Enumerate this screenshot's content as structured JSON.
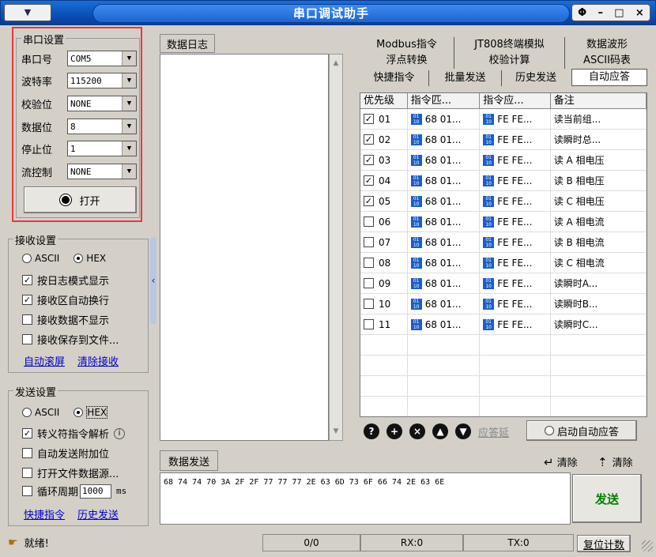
{
  "title": "串口调试助手",
  "window_ctrls": {
    "restore": "Φ",
    "min": "–",
    "max": "□",
    "close": "×"
  },
  "serial": {
    "group": "串口设置",
    "rows": [
      {
        "label": "串口号",
        "value": "COM5"
      },
      {
        "label": "波特率",
        "value": "115200"
      },
      {
        "label": "校验位",
        "value": "NONE"
      },
      {
        "label": "数据位",
        "value": "8"
      },
      {
        "label": "停止位",
        "value": "1"
      },
      {
        "label": "流控制",
        "value": "NONE"
      }
    ],
    "open_btn": "打开"
  },
  "receive": {
    "group": "接收设置",
    "ascii": "ASCII",
    "hex": "HEX",
    "opts": [
      "按日志模式显示",
      "接收区自动换行",
      "接收数据不显示",
      "接收保存到文件..."
    ],
    "opts_checked": [
      true,
      true,
      false,
      false
    ],
    "link1": "自动滚屏",
    "link2": "清除接收"
  },
  "send": {
    "group": "发送设置",
    "ascii": "ASCII",
    "hex": "HEX",
    "opts": [
      "转义符指令解析",
      "自动发送附加位",
      "打开文件数据源...",
      "循环周期"
    ],
    "opts_checked": [
      true,
      false,
      false,
      false
    ],
    "period": "1000",
    "period_unit": "ms",
    "link1": "快捷指令",
    "link2": "历史发送"
  },
  "log": {
    "label": "数据日志"
  },
  "send_area": {
    "label": "数据发送",
    "clear1": "清除",
    "clear2": "清除",
    "text": "68 74 74 70 3A 2F 2F 77 77 77 2E 63 6D 73 6F 66 74 2E 63 6E",
    "send_btn": "发送"
  },
  "tabs": {
    "row1": [
      "Modbus指令",
      "JT808终端模拟",
      "数据波形"
    ],
    "row2": [
      "浮点转换",
      "校验计算",
      "ASCII码表"
    ],
    "row3": [
      "快捷指令",
      "批量发送",
      "历史发送",
      "自动应答"
    ]
  },
  "table": {
    "headers": [
      "优先级",
      "指令匹...",
      "指令应...",
      "备注"
    ],
    "rows": [
      {
        "id": "01",
        "match": "68 01...",
        "resp": "FE FE...",
        "note": "读当前组...",
        "checked": true
      },
      {
        "id": "02",
        "match": "68 01...",
        "resp": "FE FE...",
        "note": "读瞬时总...",
        "checked": true
      },
      {
        "id": "03",
        "match": "68 01...",
        "resp": "FE FE...",
        "note": "读 A 相电压",
        "checked": true
      },
      {
        "id": "04",
        "match": "68 01...",
        "resp": "FE FE...",
        "note": "读 B 相电压",
        "checked": true
      },
      {
        "id": "05",
        "match": "68 01...",
        "resp": "FE FE...",
        "note": "读 C 相电压",
        "checked": true
      },
      {
        "id": "06",
        "match": "68 01...",
        "resp": "FE FE...",
        "note": "读 A 相电流",
        "checked": false
      },
      {
        "id": "07",
        "match": "68 01...",
        "resp": "FE FE...",
        "note": "读 B 相电流",
        "checked": false
      },
      {
        "id": "08",
        "match": "68 01...",
        "resp": "FE FE...",
        "note": "读 C 相电流",
        "checked": false
      },
      {
        "id": "09",
        "match": "68 01...",
        "resp": "FE FE...",
        "note": "读瞬时A...",
        "checked": false
      },
      {
        "id": "10",
        "match": "68 01...",
        "resp": "FE FE...",
        "note": "读瞬时B...",
        "checked": false
      },
      {
        "id": "11",
        "match": "68 01...",
        "resp": "FE FE...",
        "note": "读瞬时C...",
        "checked": false
      }
    ]
  },
  "tbl_ctrl": {
    "delay_lbl": "应答延",
    "auto_btn": "启动自动应答"
  },
  "status": {
    "ready": "就绪!",
    "count": "0/0",
    "rx": "RX:0",
    "tx": "TX:0",
    "reset": "复位计数"
  },
  "colors": {
    "highlight_border": "#e8383d",
    "send_text": "#008000"
  }
}
